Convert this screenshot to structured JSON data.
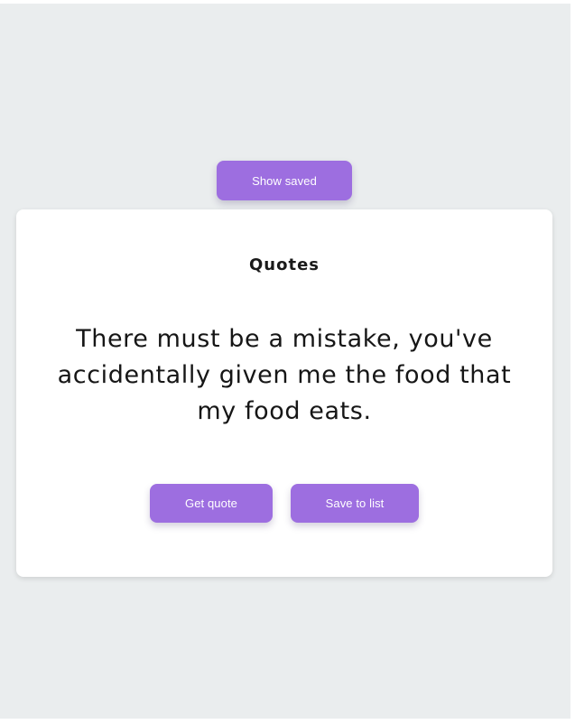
{
  "header": {
    "show_saved_label": "Show saved"
  },
  "card": {
    "title": "Quotes",
    "quote": "There must be a mistake, you've accidentally given me the food that my food eats.",
    "get_quote_label": "Get quote",
    "save_label": "Save to list"
  },
  "colors": {
    "accent": "#9d6ee0",
    "background": "#eaedee",
    "card": "#ffffff"
  }
}
